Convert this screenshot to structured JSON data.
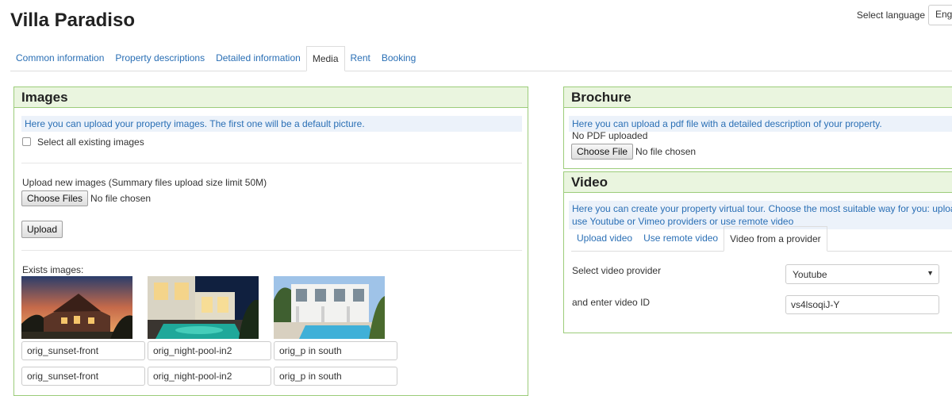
{
  "header": {
    "title": "Villa Paradiso",
    "language_label": "Select language",
    "language_value": "Eng"
  },
  "tabs": [
    {
      "label": "Common information"
    },
    {
      "label": "Property descriptions"
    },
    {
      "label": "Detailed information"
    },
    {
      "label": "Media"
    },
    {
      "label": "Rent"
    },
    {
      "label": "Booking"
    }
  ],
  "images": {
    "title": "Images",
    "info": "Here you can upload your property images. The first one will be a default picture.",
    "select_all_label": "Select all existing images",
    "upload_label": "Upload new images (Summary files upload size limit 50M)",
    "choose_files_label": "Choose Files",
    "no_file_text": "No file chosen",
    "upload_button": "Upload",
    "exists_label": "Exists images:",
    "items": [
      {
        "name": "orig_sunset-front",
        "icon": "house-sunset-photo"
      },
      {
        "name": "orig_night-pool-in2",
        "icon": "night-pool-photo"
      },
      {
        "name": "orig_p in south",
        "icon": "pool-south-photo"
      }
    ],
    "second_row": [
      "orig_sunset-front",
      "orig_night-pool-in2",
      "orig_p in south"
    ]
  },
  "brochure": {
    "title": "Brochure",
    "info": "Here you can upload a pdf file with a detailed description of your property.",
    "status": "No PDF uploaded",
    "choose_file_label": "Choose File",
    "no_file_text": "No file chosen"
  },
  "video": {
    "title": "Video",
    "info_line1": "Here you can create your property virtual tour. Choose the most suitable way for you: upload vic",
    "info_line2": "use Youtube or Vimeo providers or use remote video",
    "tabs": [
      {
        "label": "Upload video"
      },
      {
        "label": "Use remote video"
      },
      {
        "label": "Video from a provider"
      }
    ],
    "provider_label": "Select video provider",
    "provider_value": "Youtube",
    "id_label": "and enter video ID",
    "id_value": "vs4lsoqiJ-Y"
  },
  "colors": {
    "accent_link": "#2a6fb5",
    "panel_border": "#9ccc7a",
    "panel_header_bg": "#eaf5df",
    "info_bg": "#ecf2fa"
  }
}
